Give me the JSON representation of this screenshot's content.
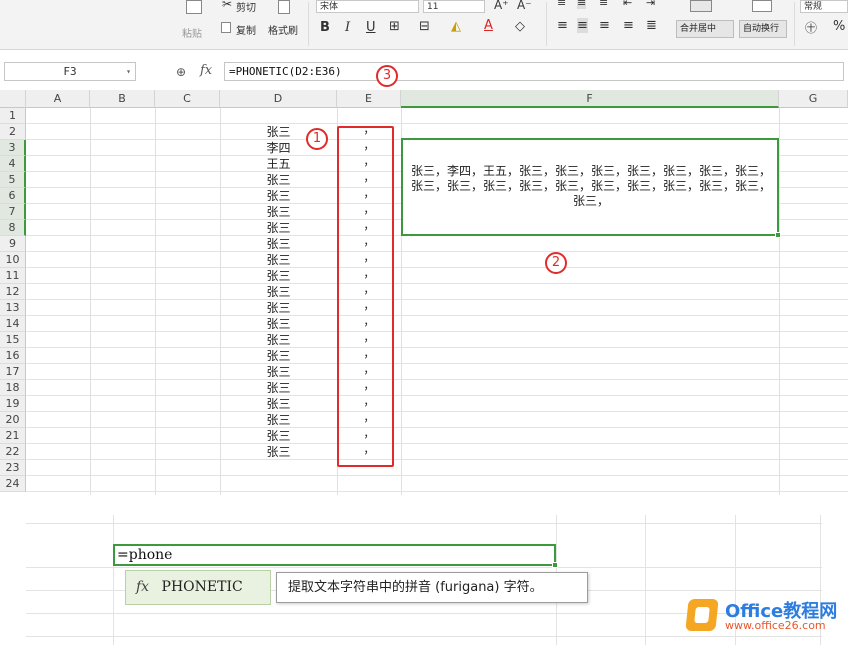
{
  "ribbon": {
    "paste": "粘贴",
    "cut": "剪切",
    "copy": "复制",
    "format_painter": "格式刷",
    "font_name": "宋体",
    "font_size": "11",
    "bold": "B",
    "italic": "I",
    "underline": "U",
    "grow_font": "A⁺",
    "shrink_font": "A⁻",
    "merge_center": "合并居中",
    "auto_wrap": "自动换行",
    "number_format": "常规",
    "percent": "%"
  },
  "formula_bar": {
    "cell_ref": "F3",
    "fx": "fx",
    "formula": "=PHONETIC(D2:E36)"
  },
  "columns": [
    "A",
    "B",
    "C",
    "D",
    "E",
    "F",
    "G"
  ],
  "rows": [
    "1",
    "2",
    "3",
    "4",
    "5",
    "6",
    "7",
    "8",
    "9",
    "10",
    "11",
    "12",
    "13",
    "14",
    "15",
    "16",
    "17",
    "18",
    "19",
    "20",
    "21",
    "22",
    "23",
    "24"
  ],
  "col_d": [
    "张三",
    "李四",
    "王五",
    "张三",
    "张三",
    "张三",
    "张三",
    "张三",
    "张三",
    "张三",
    "张三",
    "张三",
    "张三",
    "张三",
    "张三",
    "张三",
    "张三",
    "张三",
    "张三",
    "张三",
    "张三"
  ],
  "col_e_sep": "，",
  "f3_result": "张三，李四，王五，张三，张三，张三，张三，张三，张三，张三，张三，张三，张三，张三，张三，张三，张三，张三，张三，张三，张三，",
  "callouts": {
    "c1": "1",
    "c2": "2",
    "c3": "3"
  },
  "autocomplete": {
    "typed": "=phone",
    "fx": "fx",
    "function_name": "PHONETIC",
    "tooltip": "提取文本字符串中的拼音 (furigana) 字符。"
  },
  "watermark": {
    "title": "Office教程网",
    "url": "www.office26.com"
  },
  "colors": {
    "selection": "#3c9a3c",
    "annotation": "#e02b2b",
    "logo_blue": "#2d7de0",
    "logo_orange": "#f5a623"
  }
}
